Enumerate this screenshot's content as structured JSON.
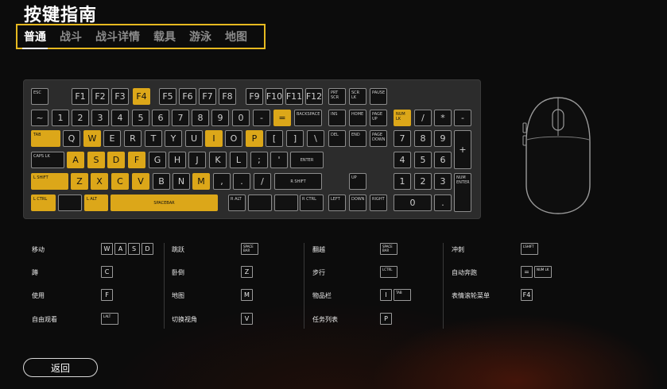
{
  "title": "按键指南",
  "tabs": [
    "普通",
    "战斗",
    "战斗详情",
    "载具",
    "游泳",
    "地图"
  ],
  "active_tab": "普通",
  "keyboard_rows": [
    [
      {
        "l": "ESC",
        "s": 1
      },
      {
        "l": "F1"
      },
      {
        "l": "F2"
      },
      {
        "l": "F3"
      },
      {
        "l": "F4",
        "h": 1
      },
      {
        "l": "F5"
      },
      {
        "l": "F6"
      },
      {
        "l": "F7"
      },
      {
        "l": "F8"
      },
      {
        "l": "F9"
      },
      {
        "l": "F10"
      },
      {
        "l": "F11"
      },
      {
        "l": "F12"
      },
      {
        "l": "PRT SCR",
        "s": 1
      },
      {
        "l": "SCR LK",
        "s": 1
      },
      {
        "l": "PAUSE",
        "s": 1
      }
    ],
    [
      {
        "l": "~"
      },
      {
        "l": "1"
      },
      {
        "l": "2"
      },
      {
        "l": "3"
      },
      {
        "l": "4"
      },
      {
        "l": "5"
      },
      {
        "l": "6"
      },
      {
        "l": "7"
      },
      {
        "l": "8"
      },
      {
        "l": "9"
      },
      {
        "l": "0"
      },
      {
        "l": "-"
      },
      {
        "l": "=",
        "h": 1
      },
      {
        "l": "BACKSPACE",
        "s": 1
      },
      {
        "l": "INS",
        "s": 1
      },
      {
        "l": "HOME",
        "s": 1
      },
      {
        "l": "PAGE UP",
        "s": 1
      },
      {
        "l": "NUM LK",
        "s": 1,
        "h": 1
      },
      {
        "l": "/"
      },
      {
        "l": "*"
      },
      {
        "l": "-"
      }
    ],
    [
      {
        "l": "TAB",
        "s": 1,
        "h": 1
      },
      {
        "l": "Q"
      },
      {
        "l": "W",
        "h": 1
      },
      {
        "l": "E"
      },
      {
        "l": "R"
      },
      {
        "l": "T"
      },
      {
        "l": "Y"
      },
      {
        "l": "U"
      },
      {
        "l": "I",
        "h": 1
      },
      {
        "l": "O"
      },
      {
        "l": "P",
        "h": 1
      },
      {
        "l": "["
      },
      {
        "l": "]"
      },
      {
        "l": "\\"
      },
      {
        "l": "DEL",
        "s": 1
      },
      {
        "l": "END",
        "s": 1
      },
      {
        "l": "PAGE DOWN",
        "s": 1
      },
      {
        "l": "7"
      },
      {
        "l": "8"
      },
      {
        "l": "9"
      },
      {
        "l": "+"
      }
    ],
    [
      {
        "l": "CAPS LK",
        "s": 1
      },
      {
        "l": "A",
        "h": 1
      },
      {
        "l": "S",
        "h": 1
      },
      {
        "l": "D",
        "h": 1
      },
      {
        "l": "F",
        "h": 1
      },
      {
        "l": "G"
      },
      {
        "l": "H"
      },
      {
        "l": "J"
      },
      {
        "l": "K"
      },
      {
        "l": "L"
      },
      {
        "l": ";"
      },
      {
        "l": "'"
      },
      {
        "l": "ENTER",
        "s": 1
      },
      {
        "l": "4"
      },
      {
        "l": "5"
      },
      {
        "l": "6"
      }
    ],
    [
      {
        "l": "L SHIFT",
        "s": 1,
        "h": 1
      },
      {
        "l": "Z",
        "h": 1
      },
      {
        "l": "X",
        "h": 1
      },
      {
        "l": "C",
        "h": 1
      },
      {
        "l": "V",
        "h": 1
      },
      {
        "l": "B"
      },
      {
        "l": "N"
      },
      {
        "l": "M",
        "h": 1
      },
      {
        "l": ","
      },
      {
        "l": "."
      },
      {
        "l": "/"
      },
      {
        "l": "R SHIFT",
        "s": 1
      },
      {
        "l": "UP",
        "s": 1
      },
      {
        "l": "1"
      },
      {
        "l": "2"
      },
      {
        "l": "3"
      },
      {
        "l": "NUM ENTER",
        "s": 1
      }
    ],
    [
      {
        "l": "L CTRL",
        "s": 1,
        "h": 1
      },
      {
        "l": ""
      },
      {
        "l": "L ALT",
        "s": 1,
        "h": 1
      },
      {
        "l": "SPACEBAR",
        "s": 1,
        "h": 1
      },
      {
        "l": "R ALT",
        "s": 1
      },
      {
        "l": ""
      },
      {
        "l": ""
      },
      {
        "l": "R CTRL",
        "s": 1
      },
      {
        "l": "LEFT",
        "s": 1
      },
      {
        "l": "DOWN",
        "s": 1
      },
      {
        "l": "RIGHT",
        "s": 1
      },
      {
        "l": "0"
      },
      {
        "l": "."
      }
    ]
  ],
  "bindings": [
    {
      "label": "移动",
      "keys": [
        {
          "k": "W"
        },
        {
          "k": "A"
        },
        {
          "k": "S"
        },
        {
          "k": "D"
        }
      ]
    },
    {
      "label": "跳跃",
      "keys": [
        {
          "k": "SPACE BAR",
          "s": 1
        }
      ]
    },
    {
      "label": "翻越",
      "keys": [
        {
          "k": "SPACE BAR",
          "s": 1
        }
      ]
    },
    {
      "label": "冲刺",
      "keys": [
        {
          "k": "LSHIFT",
          "s": 1
        }
      ]
    },
    {
      "label": "蹲",
      "keys": [
        {
          "k": "C"
        }
      ]
    },
    {
      "label": "卧倒",
      "keys": [
        {
          "k": "Z"
        }
      ]
    },
    {
      "label": "步行",
      "keys": [
        {
          "k": "LCTRL",
          "s": 1
        }
      ]
    },
    {
      "label": "自动奔跑",
      "keys": [
        {
          "k": "="
        },
        {
          "k": "NUM LK",
          "s": 1
        }
      ]
    },
    {
      "label": "使用",
      "keys": [
        {
          "k": "F"
        }
      ]
    },
    {
      "label": "地图",
      "keys": [
        {
          "k": "M"
        }
      ]
    },
    {
      "label": "物品栏",
      "keys": [
        {
          "k": "I"
        },
        {
          "k": "TAB",
          "s": 1
        }
      ]
    },
    {
      "label": "表情滚轮菜单",
      "keys": [
        {
          "k": "F4"
        }
      ]
    },
    {
      "label": "自由观看",
      "keys": [
        {
          "k": "LALT",
          "s": 1
        }
      ]
    },
    {
      "label": "切换视角",
      "keys": [
        {
          "k": "V"
        }
      ]
    },
    {
      "label": "任务列表",
      "keys": [
        {
          "k": "P"
        }
      ]
    }
  ],
  "back_label": "返回",
  "colors": {
    "highlight": "#dca719",
    "tab_border": "#e6b920"
  }
}
